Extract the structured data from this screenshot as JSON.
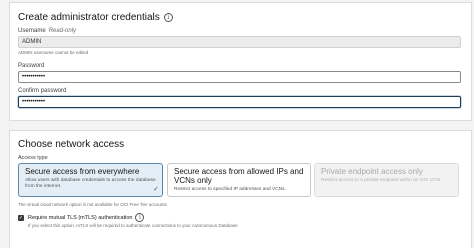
{
  "credentials": {
    "title": "Create administrator credentials",
    "username_label": "Username",
    "username_readonly_note": "Read-only",
    "username_value": "ADMIN",
    "username_hint": "ADMIN username cannot be edited",
    "password_label": "Password",
    "password_value": "•••••••••••",
    "confirm_label": "Confirm password",
    "confirm_value": "•••••••••••"
  },
  "network": {
    "title": "Choose network access",
    "access_type_label": "Access type",
    "options": [
      {
        "title": "Secure access from everywhere",
        "description": "Allow users with database credentials to access the database from the internet.",
        "selected": true,
        "disabled": false
      },
      {
        "title": "Secure access from allowed IPs and VCNs only",
        "description": "Restrict access to specified IP addresses and VCNs.",
        "selected": false,
        "disabled": false
      },
      {
        "title": "Private endpoint access only",
        "description": "Restrict access to a private endpoint within an OCI VCN",
        "selected": false,
        "disabled": true
      }
    ],
    "free_tier_note": "The virtual cloud network option is not available for OCI Free Tier accounts",
    "mtls_label": "Require mutual TLS (mTLS) authentication",
    "mtls_checked": true,
    "mtls_hint": "If you select this option, mTLS will be required to authenticate connections to your Autonomous Database"
  },
  "icons": {
    "info": "info-icon",
    "check": "checkmark-icon",
    "checkbox": "checkbox-checked-icon"
  },
  "colors": {
    "selected_card_bg": "#e4eef6",
    "selected_card_border": "#5a87a8",
    "focus_border": "#1f3c58"
  }
}
